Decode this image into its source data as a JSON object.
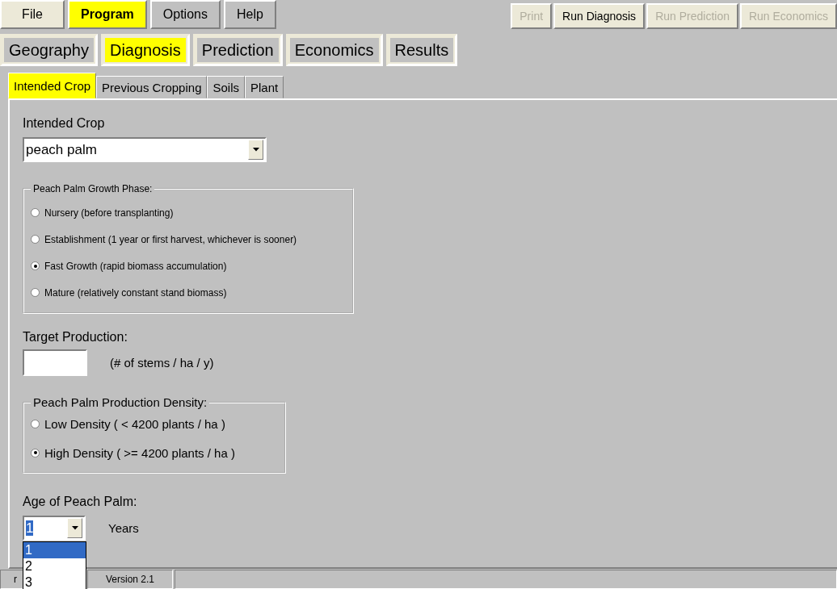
{
  "menu": [
    {
      "label": "File",
      "selected": false
    },
    {
      "label": "Program",
      "selected": true
    },
    {
      "label": "Options",
      "selected": false
    },
    {
      "label": "Help",
      "selected": false
    }
  ],
  "actions": [
    {
      "label": "Print",
      "disabled": true
    },
    {
      "label": "Run Diagnosis",
      "disabled": false
    },
    {
      "label": "Run Prediction",
      "disabled": true
    },
    {
      "label": "Run Economics",
      "disabled": true
    }
  ],
  "tabs": [
    {
      "label": "Geography",
      "selected": false
    },
    {
      "label": "Diagnosis",
      "selected": true
    },
    {
      "label": "Prediction",
      "selected": false
    },
    {
      "label": "Economics",
      "selected": false
    },
    {
      "label": "Results",
      "selected": false
    }
  ],
  "subtabs": [
    {
      "label": "Intended Crop",
      "selected": true
    },
    {
      "label": "Previous Cropping",
      "selected": false
    },
    {
      "label": "Soils",
      "selected": false
    },
    {
      "label": "Plant",
      "selected": false
    }
  ],
  "form": {
    "crop_label": "Intended Crop",
    "crop_value": "peach palm",
    "growth_phase": {
      "legend": "Peach Palm Growth Phase:",
      "options": [
        {
          "label": "Nursery (before transplanting)",
          "selected": false
        },
        {
          "label": "Establishment (1 year or first harvest, whichever is sooner)",
          "selected": false
        },
        {
          "label": "Fast Growth (rapid biomass accumulation)",
          "selected": true
        },
        {
          "label": "Mature (relatively constant stand biomass)",
          "selected": false
        }
      ]
    },
    "target": {
      "label": "Target Production:",
      "unit": "(# of stems / ha / y)"
    },
    "density": {
      "legend": "Peach Palm Production Density:",
      "options": [
        {
          "label": "Low Density ( < 4200 plants / ha )",
          "selected": false
        },
        {
          "label": "High Density ( >= 4200 plants / ha )",
          "selected": true
        }
      ]
    },
    "age": {
      "label": "Age of Peach Palm:",
      "value": "1",
      "unit": "Years",
      "options": [
        {
          "label": "1",
          "selected": true
        },
        {
          "label": "2",
          "selected": false
        },
        {
          "label": "3",
          "selected": false
        }
      ]
    }
  },
  "status_bar": {
    "panels": [
      "r",
      "Version 2.1"
    ]
  }
}
